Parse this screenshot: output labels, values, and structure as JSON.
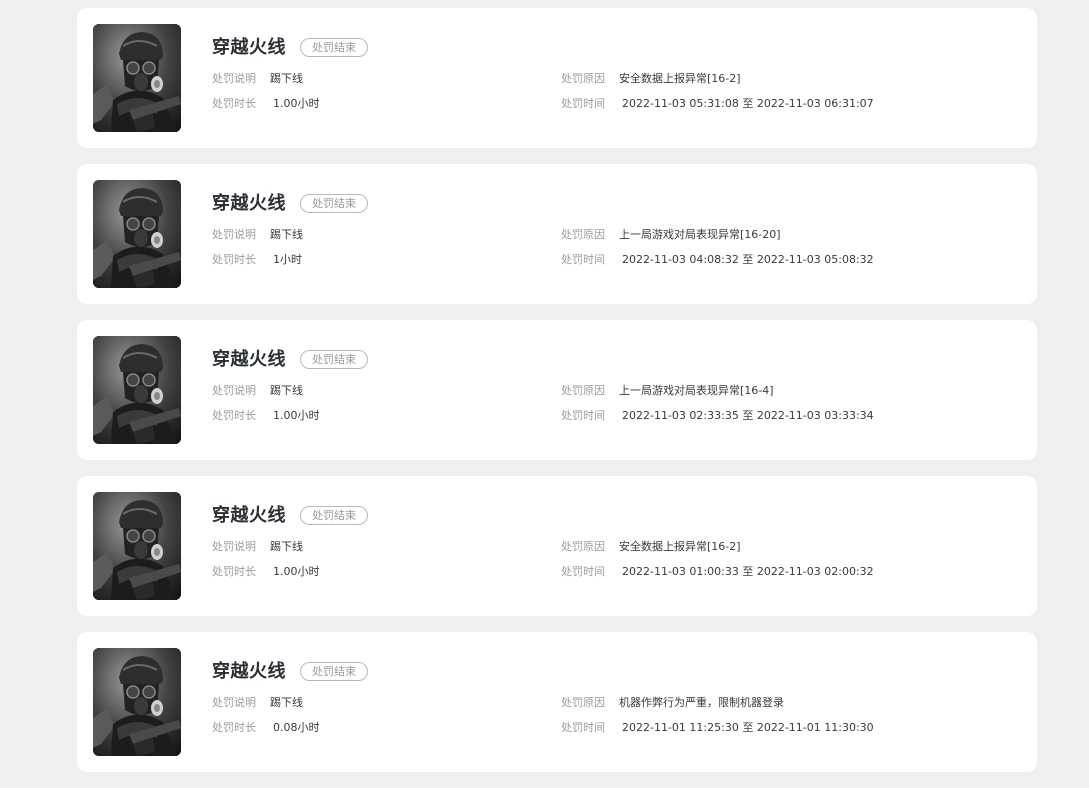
{
  "labels": {
    "description": "处罚说明",
    "duration": "处罚时长",
    "reason": "处罚原因",
    "time": "处罚时间"
  },
  "records": [
    {
      "game": "穿越火线",
      "status": "处罚结束",
      "description": "踢下线",
      "duration": "1.00小时",
      "reason": "安全数据上报异常[16-2]",
      "time": "2022-11-03 05:31:08 至 2022-11-03 06:31:07"
    },
    {
      "game": "穿越火线",
      "status": "处罚结束",
      "description": "踢下线",
      "duration": "1小时",
      "reason": "上一局游戏对局表现异常[16-20]",
      "time": "2022-11-03 04:08:32 至 2022-11-03 05:08:32"
    },
    {
      "game": "穿越火线",
      "status": "处罚结束",
      "description": "踢下线",
      "duration": "1.00小时",
      "reason": "上一局游戏对局表现异常[16-4]",
      "time": "2022-11-03 02:33:35 至 2022-11-03 03:33:34"
    },
    {
      "game": "穿越火线",
      "status": "处罚结束",
      "description": "踢下线",
      "duration": "1.00小时",
      "reason": "安全数据上报异常[16-2]",
      "time": "2022-11-03 01:00:33 至 2022-11-03 02:00:32"
    },
    {
      "game": "穿越火线",
      "status": "处罚结束",
      "description": "踢下线",
      "duration": "0.08小时",
      "reason": "机器作弊行为严重，限制机器登录",
      "time": "2022-11-01 11:25:30 至 2022-11-01 11:30:30"
    }
  ]
}
